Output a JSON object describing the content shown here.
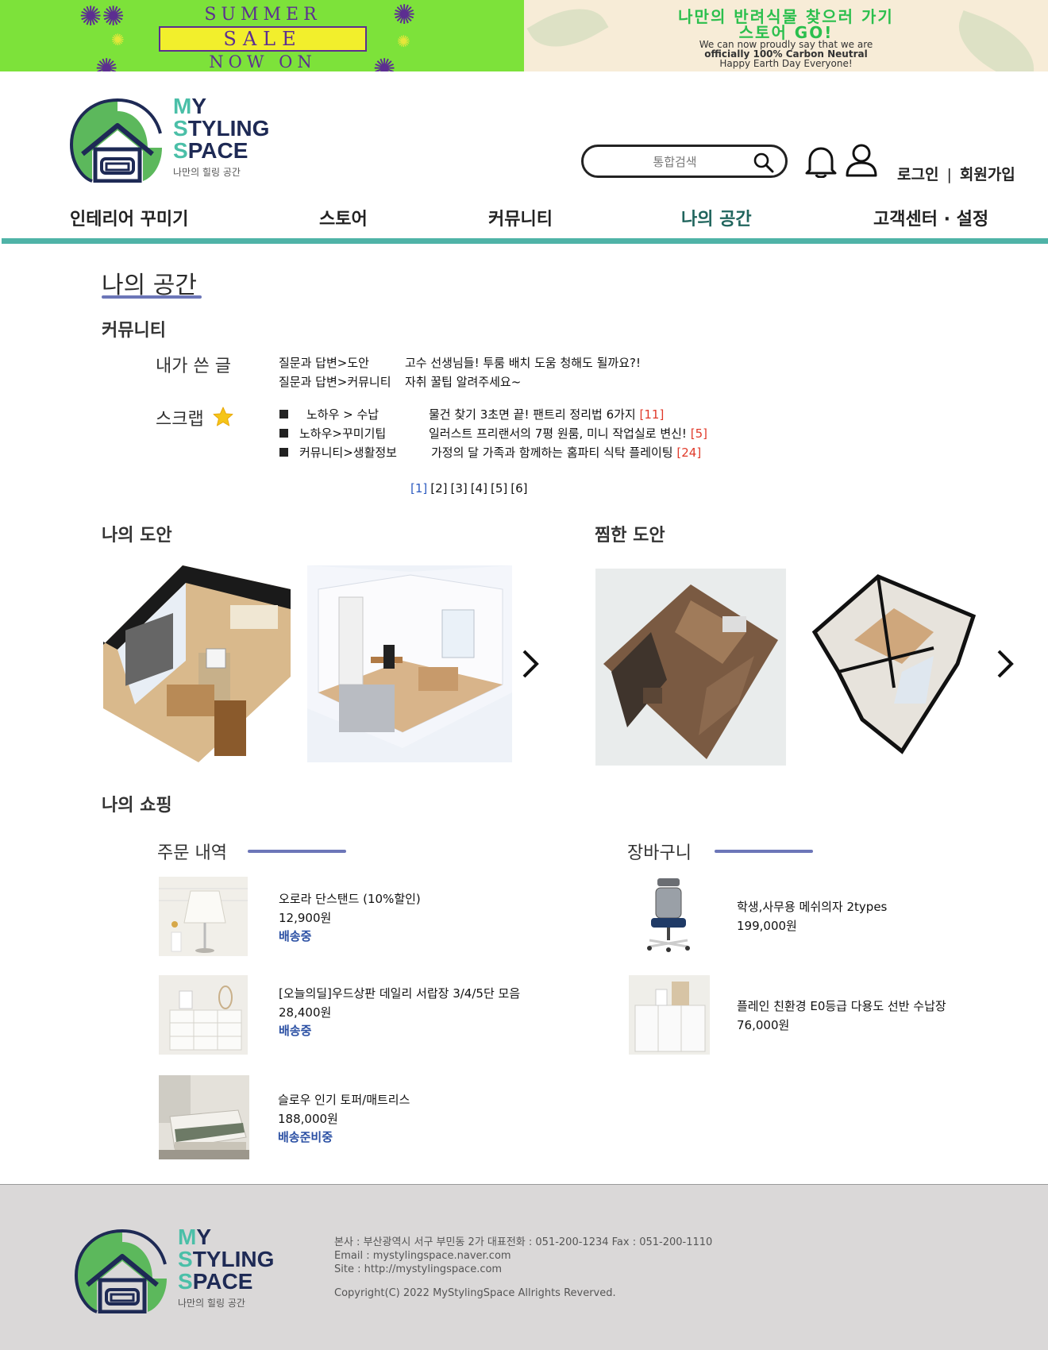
{
  "banner": {
    "sale": {
      "line1": "SUMMER",
      "line2": "SALE",
      "line3": "NOW ON"
    },
    "eco": {
      "line1": "나만의 반려식물 찾으러 가기",
      "line2": "스토어 GO!",
      "small1": "We can now proudly say that we are",
      "small2": "officially 100% Carbon Neutral",
      "small3": "Happy Earth Day Everyone!"
    }
  },
  "brand": {
    "line1_acc": "M",
    "line1_rest": "Y",
    "line2_acc": "S",
    "line2_rest": "TYLING",
    "line3_acc": "S",
    "line3_rest": "PACE",
    "tagline": "나만의 힐링 공간"
  },
  "header": {
    "search_placeholder": "통합검색",
    "login": "로그인",
    "separator": "|",
    "signup": "회원가입"
  },
  "nav": {
    "items": [
      "인테리어 꾸미기",
      "스토어",
      "커뮤니티",
      "나의 공간",
      "고객센터 · 설정"
    ],
    "active_index": 3
  },
  "page": {
    "title": "나의 공간"
  },
  "community": {
    "heading": "커뮤니티",
    "my_posts_label": "내가 쓴 글",
    "my_posts": [
      {
        "category": "질문과 답변>도안",
        "title": "고수 선생님들! 투룸 배치 도움 청해도 될까요?!"
      },
      {
        "category": "질문과 답변>커뮤니티",
        "title": "자취 꿀팁 알려주세요~"
      }
    ],
    "scrap_label": "스크랩",
    "scraps": [
      {
        "category": "노하우 > 수납",
        "title": "물건 찾기 3초면 끝! 팬트리 정리법 6가지",
        "count": "[11]"
      },
      {
        "category": "노하우>꾸미기팁",
        "title": "일러스트 프리랜서의 7평 원룸, 미니 작업실로 변신!",
        "count": "[5]"
      },
      {
        "category": "커뮤니티>생활정보",
        "title": "가정의 달 가족과 함께하는 홈파티 식탁 플레이팅",
        "count": "[24]"
      }
    ],
    "pages": [
      "[1]",
      "[2]",
      "[3]",
      "[4]",
      "[5]",
      "[6]"
    ],
    "current_page": "[1]"
  },
  "designs": {
    "mine_heading": "나의 도안",
    "liked_heading": "찜한 도안"
  },
  "shopping": {
    "heading": "나의 쇼핑",
    "orders_heading": "주문 내역",
    "orders": [
      {
        "name": "오로라 단스탠드 (10%할인)",
        "price": "12,900원",
        "status": "배송중"
      },
      {
        "name": "[오늘의딜]우드상판 데일리 서랍장 3/4/5단 모음",
        "price": "28,400원",
        "status": "배송중"
      },
      {
        "name": "슬로우 인기 토퍼/매트리스",
        "price": "188,000원",
        "status": "배송준비중"
      }
    ],
    "cart_heading": "장바구니",
    "cart": [
      {
        "name": "학생,사무용 메쉬의자 2types",
        "price": "199,000원"
      },
      {
        "name": "플레인 친환경 E0등급 다용도 선반 수납장",
        "price": "76,000원"
      }
    ]
  },
  "footer": {
    "address": "본사 : 부산광역시 서구 부민동 2가  대표전화 : 051-200-1234 Fax : 051-200-1110",
    "email": "Email : mystylingspace.naver.com",
    "site": "Site : http://mystylingspace.com",
    "copyright": "Copyright(C) 2022 MyStylingSpace Allrights Reverved."
  },
  "colors": {
    "accent_teal": "#4fb3a7",
    "nav_active": "#20655d",
    "title_underline": "#6c76b8",
    "count_red": "#e03a2a",
    "status_blue": "#2a4fa3",
    "banner_green": "#7de23a"
  }
}
